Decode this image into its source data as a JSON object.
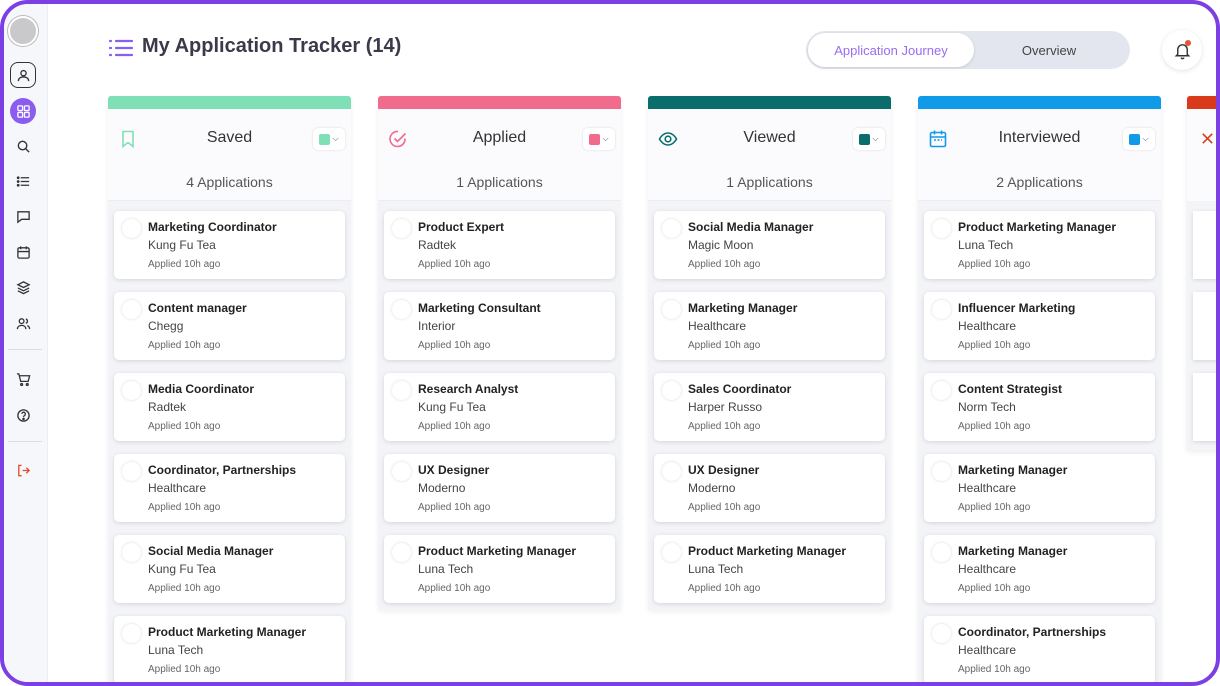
{
  "header": {
    "title": "My Application Tracker (14)",
    "toggle": {
      "active": "Application Journey",
      "inactive": "Overview"
    }
  },
  "colors": {
    "accent": "#8a5cf0",
    "frame": "#7b3fe4",
    "saved": "#7fe0b8",
    "applied": "#f06b8c",
    "viewed": "#086d6b",
    "interviewed": "#119ae8",
    "rejected": "#d93a1c"
  },
  "sidebar": {
    "icons": [
      "avatar",
      "profile-icon",
      "grid-icon",
      "search-icon",
      "list-icon",
      "chat-icon",
      "calendar-icon",
      "layers-icon",
      "users-icon",
      "cart-icon",
      "help-icon",
      "logout-icon"
    ]
  },
  "columns": [
    {
      "title": "Saved",
      "count": "4 Applications",
      "icon": "bookmark-icon",
      "cards": [
        {
          "title": "Marketing Coordinator",
          "company": "Kung Fu Tea",
          "time": "Applied 10h ago"
        },
        {
          "title": "Content manager",
          "company": "Chegg",
          "time": "Applied 10h ago"
        },
        {
          "title": "Media Coordinator",
          "company": "Radtek",
          "time": "Applied 10h ago"
        },
        {
          "title": "Coordinator, Partnerships",
          "company": "Healthcare",
          "time": "Applied 10h ago"
        },
        {
          "title": "Social Media Manager",
          "company": "Kung Fu Tea",
          "time": "Applied 10h ago"
        },
        {
          "title": "Product Marketing Manager",
          "company": "Luna Tech",
          "time": "Applied 10h ago"
        }
      ]
    },
    {
      "title": "Applied",
      "count": "1 Applications",
      "icon": "check-circle-icon",
      "cards": [
        {
          "title": "Product Expert",
          "company": "Radtek",
          "time": "Applied 10h ago"
        },
        {
          "title": "Marketing Consultant",
          "company": "Interior",
          "time": "Applied 10h ago"
        },
        {
          "title": "Research Analyst",
          "company": "Kung Fu Tea",
          "time": "Applied 10h ago"
        },
        {
          "title": "UX Designer",
          "company": "Moderno",
          "time": "Applied 10h ago"
        },
        {
          "title": "Product Marketing Manager",
          "company": "Luna Tech",
          "time": "Applied 10h ago"
        }
      ]
    },
    {
      "title": "Viewed",
      "count": "1 Applications",
      "icon": "eye-icon",
      "cards": [
        {
          "title": "Social Media Manager",
          "company": "Magic Moon",
          "time": "Applied 10h ago"
        },
        {
          "title": "Marketing Manager",
          "company": "Healthcare",
          "time": "Applied 10h ago"
        },
        {
          "title": "Sales Coordinator",
          "company": "Harper Russo",
          "time": "Applied 10h ago"
        },
        {
          "title": "UX Designer",
          "company": "Moderno",
          "time": "Applied 10h ago"
        },
        {
          "title": "Product Marketing Manager",
          "company": "Luna Tech",
          "time": "Applied 10h ago"
        }
      ]
    },
    {
      "title": "Interviewed",
      "count": "2 Applications",
      "icon": "calendar-icon",
      "cards": [
        {
          "title": "Product Marketing Manager",
          "company": "Luna Tech",
          "time": "Applied 10h ago"
        },
        {
          "title": "Influencer Marketing",
          "company": "Healthcare",
          "time": "Applied 10h ago"
        },
        {
          "title": "Content Strategist",
          "company": "Norm Tech",
          "time": "Applied 10h ago"
        },
        {
          "title": "Marketing Manager",
          "company": "Healthcare",
          "time": "Applied 10h ago"
        },
        {
          "title": "Marketing Manager",
          "company": "Healthcare",
          "time": "Applied 10h ago"
        },
        {
          "title": "Coordinator, Partnerships",
          "company": "Healthcare",
          "time": "Applied 10h ago"
        }
      ]
    }
  ]
}
